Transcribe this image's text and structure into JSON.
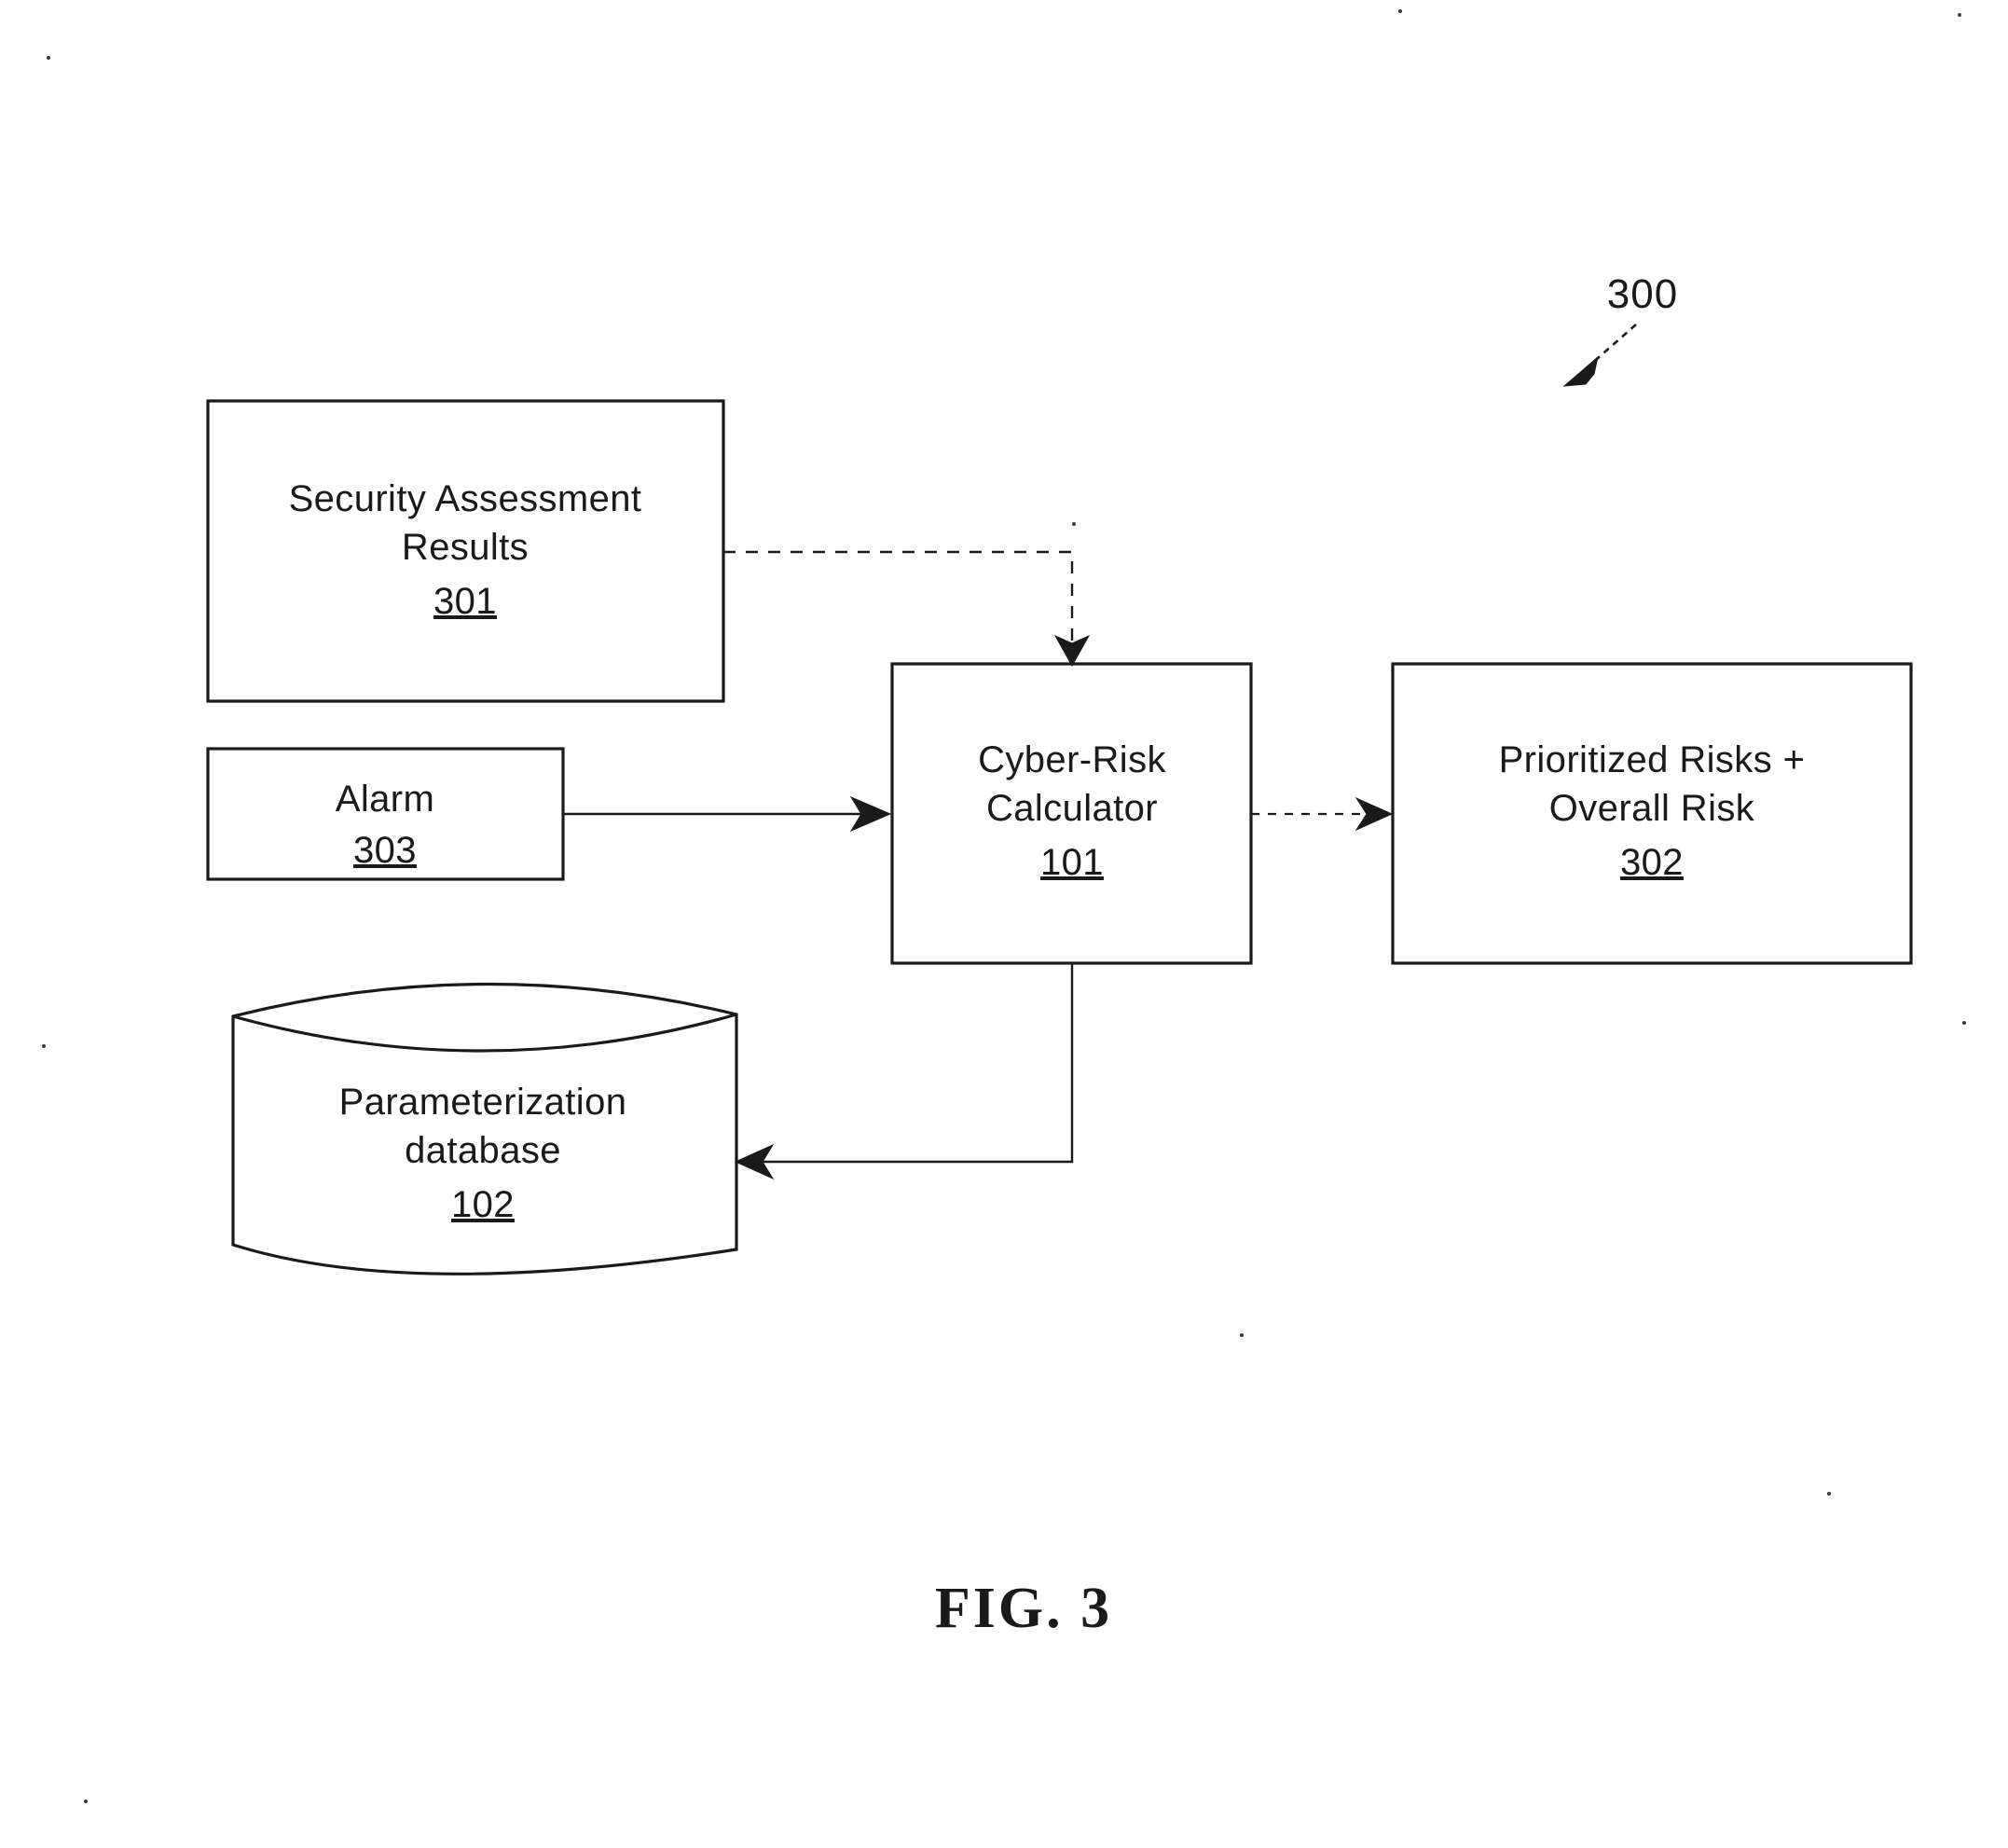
{
  "figure": {
    "caption": "FIG. 3",
    "reference_numeral": "300"
  },
  "nodes": {
    "security_assessment": {
      "line1": "Security Assessment",
      "line2": "Results",
      "ref": "301"
    },
    "alarm": {
      "line1": "Alarm",
      "ref": "303"
    },
    "cyber_risk_calculator": {
      "line1": "Cyber-Risk",
      "line2": "Calculator",
      "ref": "101"
    },
    "prioritized_risks": {
      "line1": "Prioritized Risks +",
      "line2": "Overall Risk",
      "ref": "302"
    },
    "parameterization_database": {
      "line1": "Parameterization",
      "line2": "database",
      "ref": "102"
    }
  },
  "connectors": [
    {
      "name": "security-assessment-to-calculator",
      "style": "dashed",
      "from": "security_assessment",
      "to": "cyber_risk_calculator"
    },
    {
      "name": "alarm-to-calculator",
      "style": "solid",
      "from": "alarm",
      "to": "cyber_risk_calculator"
    },
    {
      "name": "calculator-to-prioritized-risks",
      "style": "dashed",
      "from": "cyber_risk_calculator",
      "to": "prioritized_risks"
    },
    {
      "name": "calculator-to-parameterization-database",
      "style": "solid",
      "from": "cyber_risk_calculator",
      "to": "parameterization_database"
    }
  ],
  "colors": {
    "ink": "#1a1a1a",
    "paper": "#ffffff"
  }
}
